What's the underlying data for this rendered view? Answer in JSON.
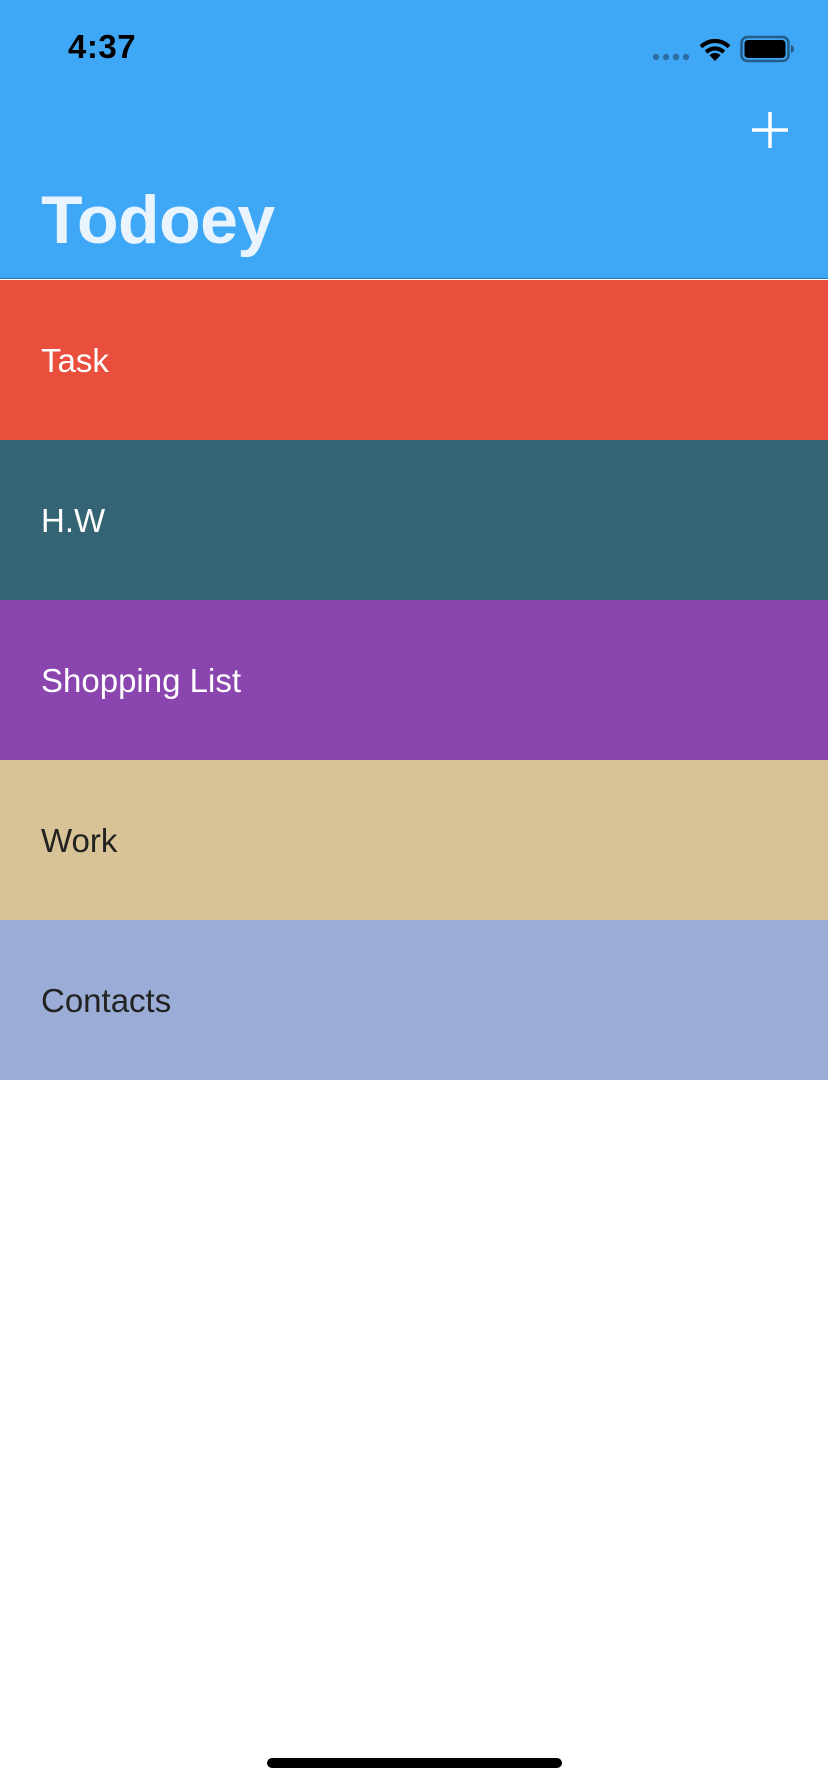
{
  "status_bar": {
    "time": "4:37"
  },
  "nav_bar": {
    "title": "Todoey",
    "add_icon": "plus-icon",
    "background_color": "#3fa8f6"
  },
  "categories": [
    {
      "label": "Task",
      "background_color": "#e94f3c",
      "text_color": "#ffffff"
    },
    {
      "label": "H.W",
      "background_color": "#356474",
      "text_color": "#ffffff"
    },
    {
      "label": "Shopping List",
      "background_color": "#8b45af",
      "text_color": "#ffffff"
    },
    {
      "label": "Work",
      "background_color": "#d7c396",
      "text_color": "#222222"
    },
    {
      "label": "Contacts",
      "background_color": "#9badd6",
      "text_color": "#222222"
    }
  ]
}
